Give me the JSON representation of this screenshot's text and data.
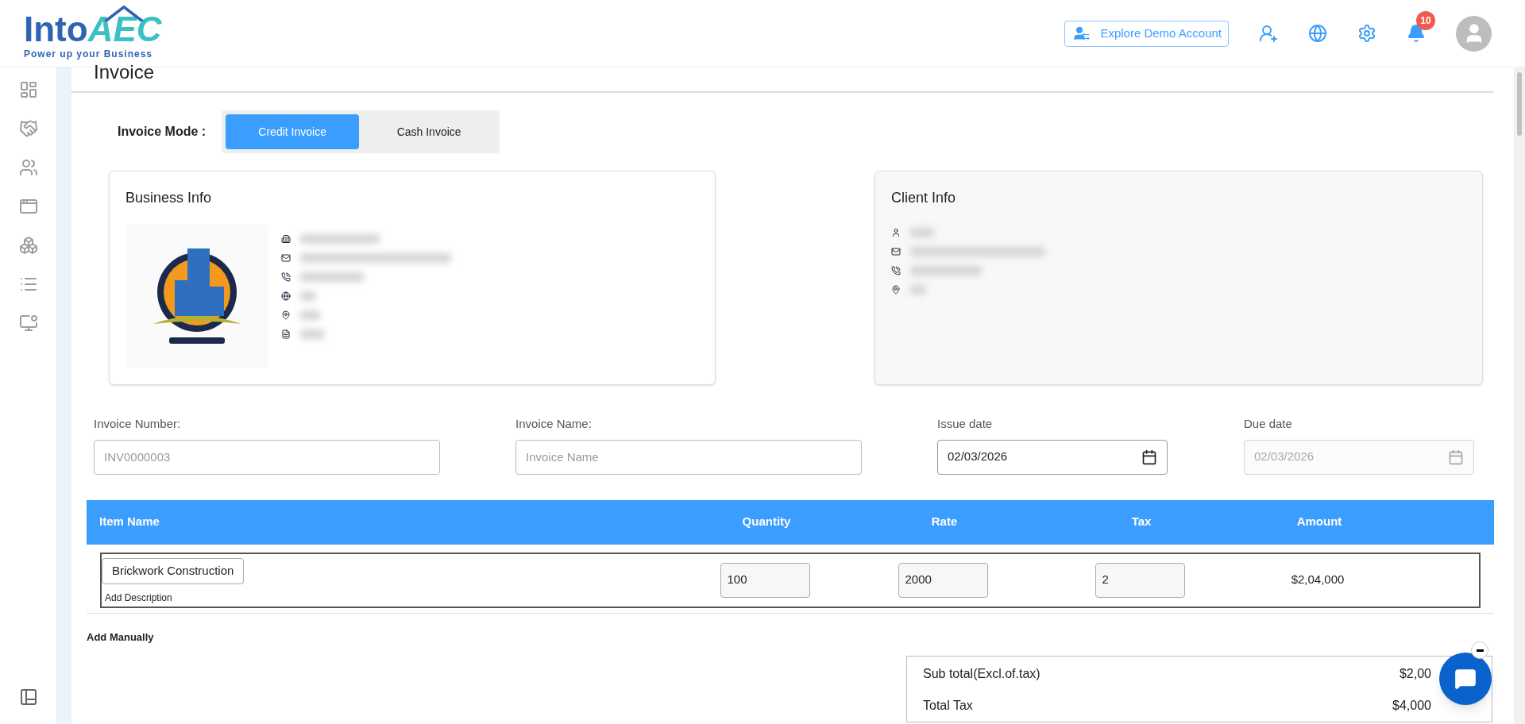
{
  "header": {
    "logo": {
      "word": "Into",
      "accent": "AEC",
      "tagline": "Power up your Business"
    },
    "demo_button": "Explore Demo Account",
    "notifications": {
      "count": "10"
    }
  },
  "sidebar": {
    "items": [
      {
        "kind": "dashboard"
      },
      {
        "kind": "handshake"
      },
      {
        "kind": "team"
      },
      {
        "kind": "layout"
      },
      {
        "kind": "modules"
      },
      {
        "kind": "list"
      },
      {
        "kind": "monitor"
      }
    ],
    "footer": {
      "kind": "panels"
    }
  },
  "page": {
    "title": "Invoice"
  },
  "mode": {
    "label": "Invoice Mode :",
    "options": [
      {
        "label": "Credit Invoice",
        "selected": true
      },
      {
        "label": "Cash Invoice",
        "selected": false
      }
    ]
  },
  "business_info": {
    "title": "Business Info",
    "rows": [
      {
        "kind": "building"
      },
      {
        "kind": "mail"
      },
      {
        "kind": "phone"
      },
      {
        "kind": "web"
      },
      {
        "kind": "location"
      },
      {
        "kind": "document"
      }
    ]
  },
  "client_info": {
    "title": "Client Info",
    "rows": [
      {
        "kind": "person"
      },
      {
        "kind": "mail"
      },
      {
        "kind": "phone"
      },
      {
        "kind": "location"
      }
    ]
  },
  "fields": [
    {
      "label": "Invoice Number:",
      "placeholder": "INV0000003",
      "kind": "text",
      "disabled": false
    },
    {
      "label": "Invoice Name:",
      "placeholder": "Invoice Name",
      "kind": "text",
      "disabled": false
    },
    {
      "label": "Issue date",
      "value": "02/03/2026",
      "kind": "date",
      "disabled": false
    },
    {
      "label": "Due date",
      "value": "02/03/2026",
      "kind": "date",
      "disabled": true
    }
  ],
  "table": {
    "columns": [
      "Item Name",
      "Quantity",
      "Rate",
      "Tax",
      "Amount"
    ],
    "rows": [
      {
        "item": "Brickwork Construction",
        "description_link": "Add Description",
        "quantity": "100",
        "rate": "2000",
        "tax": "2",
        "amount": "$2,04,000"
      }
    ]
  },
  "add_manually": "Add Manually",
  "totals": [
    {
      "label": "Sub total(Excl.of.tax)",
      "value": "$2,00"
    },
    {
      "label": "Total Tax",
      "value": "$4,000"
    }
  ]
}
